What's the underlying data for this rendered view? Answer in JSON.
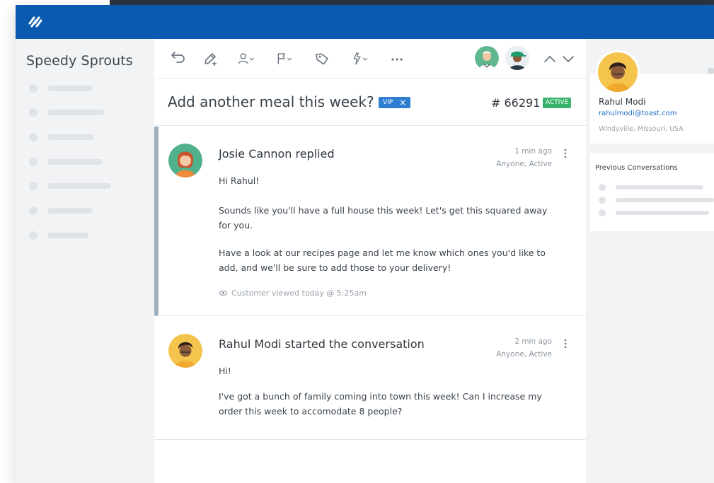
{
  "app": {
    "brand": "Speedy Sprouts",
    "accent_color": "#0a5bb0"
  },
  "toolbar": {
    "icons": [
      "undo-icon",
      "edit-icon",
      "assign-user-icon",
      "flag-icon",
      "tag-icon",
      "workflow-icon",
      "more-icon"
    ],
    "agents": [
      "agent-avatar-doctor",
      "agent-avatar-green-hat"
    ],
    "nav": [
      "previous-arrow-icon",
      "next-arrow-icon"
    ]
  },
  "conversation": {
    "subject": "Add another meal this week?",
    "tag_label": "VIP",
    "tag_remove": "×",
    "ticket_number": "# 66291",
    "status": "ACTIVE"
  },
  "threads": [
    {
      "author_line": "Josie Cannon replied",
      "time": "1 min ago",
      "meta": "Anyone, Active",
      "paragraphs": [
        "Hi Rahul!",
        "Sounds like you'll have a full house this week! Let's get this squared away for you.",
        "Have a look at our recipes page and let me know which ones you'd like to add, and we'll be sure to add those to your delivery!"
      ],
      "viewed": "Customer viewed today @ 5:25am"
    },
    {
      "author_line": "Rahul Modi started the conversation",
      "time": "2 min ago",
      "meta": "Anyone, Active",
      "paragraphs": [
        "Hi!",
        "I've got a bunch of family coming into town this week! Can I increase my order this week to accomodate 8 people?"
      ]
    }
  ],
  "customer": {
    "name": "Rahul Modi",
    "email": "rahulmodi@toast.com",
    "location": "Windyville, Missouri, USA"
  },
  "previous_conversations": {
    "title": "Previous Conversations"
  }
}
